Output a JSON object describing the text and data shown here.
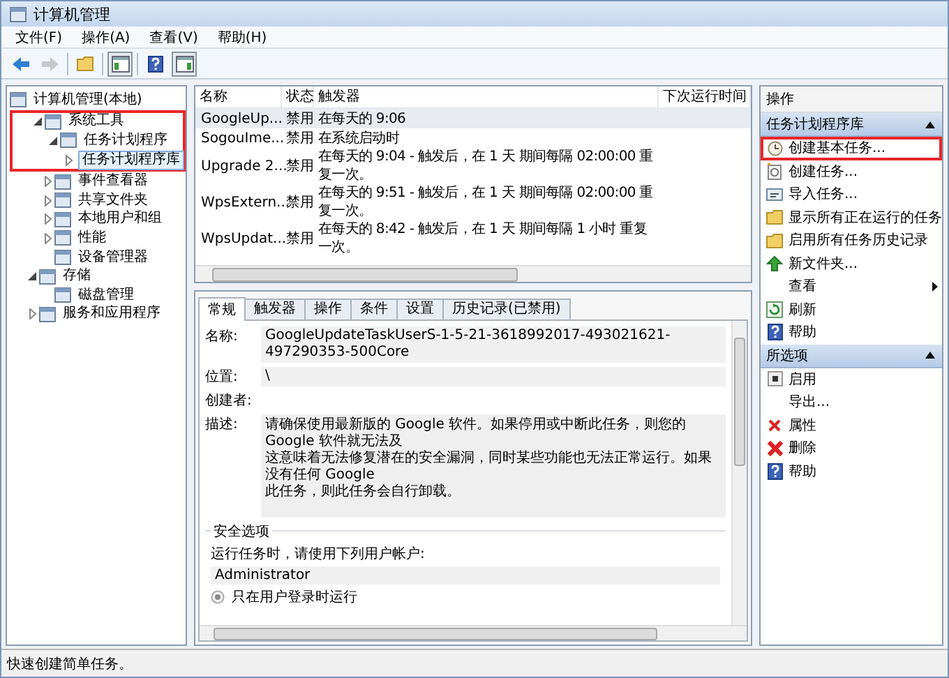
{
  "window": {
    "title": "计算机管理"
  },
  "menu": [
    "文件(F)",
    "操作(A)",
    "查看(V)",
    "帮助(H)"
  ],
  "toolbar": [
    {
      "kind": "back",
      "disabled": false
    },
    {
      "kind": "forward",
      "disabled": true
    },
    {
      "kind": "up",
      "disabled": false
    },
    {
      "kind": "tree-toggle",
      "disabled": false
    },
    {
      "kind": "help",
      "disabled": false
    },
    {
      "kind": "pane-toggle",
      "disabled": false
    }
  ],
  "tree": [
    {
      "label": "计算机管理(本地)",
      "expandable": false,
      "selected": false,
      "highlighted": false,
      "children": [
        {
          "label": "系统工具",
          "expandable": true,
          "expanded": true,
          "selected": false,
          "highlighted": true,
          "children": [
            {
              "label": "任务计划程序",
              "expandable": true,
              "expanded": true,
              "selected": false,
              "highlighted": true,
              "children": [
                {
                  "label": "任务计划程序库",
                  "expandable": true,
                  "expanded": false,
                  "selected": true,
                  "highlighted": true
                }
              ]
            },
            {
              "label": "事件查看器",
              "expandable": true,
              "expanded": false,
              "selected": false,
              "highlighted": false
            },
            {
              "label": "共享文件夹",
              "expandable": true,
              "expanded": false,
              "selected": false,
              "highlighted": false
            },
            {
              "label": "本地用户和组",
              "expandable": true,
              "expanded": false,
              "selected": false,
              "highlighted": false
            },
            {
              "label": "性能",
              "expandable": true,
              "expanded": false,
              "selected": false,
              "highlighted": false
            },
            {
              "label": "设备管理器",
              "expandable": false,
              "selected": false,
              "highlighted": false
            }
          ]
        },
        {
          "label": "存储",
          "expandable": true,
          "expanded": true,
          "selected": false,
          "highlighted": false,
          "children": [
            {
              "label": "磁盘管理",
              "expandable": false,
              "selected": false,
              "highlighted": false
            }
          ]
        },
        {
          "label": "服务和应用程序",
          "expandable": true,
          "expanded": false,
          "selected": false,
          "highlighted": false
        }
      ]
    }
  ],
  "task_list": {
    "columns": [
      "名称",
      "状态",
      "触发器",
      "下次运行时间"
    ],
    "rows": [
      {
        "name": "GoogleUp...",
        "status": "禁用",
        "trigger": "在每天的 9:06",
        "selected": true
      },
      {
        "name": "SogouIme...",
        "status": "禁用",
        "trigger": "在系统启动时",
        "selected": false
      },
      {
        "name": "Upgrade 2...",
        "status": "禁用",
        "trigger": "在每天的 9:04 - 触发后，在 1 天 期间每隔 02:00:00 重复一次。",
        "selected": false
      },
      {
        "name": "WpsExtern...",
        "status": "禁用",
        "trigger": "在每天的 9:51 - 触发后，在 1 天 期间每隔 02:00:00 重复一次。",
        "selected": false
      },
      {
        "name": "WpsUpdat...",
        "status": "禁用",
        "trigger": "在每天的 8:42 - 触发后，在 1 天 期间每隔 1 小时 重复一次。",
        "selected": false
      }
    ]
  },
  "detail": {
    "tabs": [
      {
        "label": "常规",
        "selected": true
      },
      {
        "label": "触发器",
        "selected": false
      },
      {
        "label": "操作",
        "selected": false
      },
      {
        "label": "条件",
        "selected": false
      },
      {
        "label": "设置",
        "selected": false
      },
      {
        "label": "历史记录(已禁用)",
        "selected": false
      }
    ],
    "name_label": "名称:",
    "name_value": "GoogleUpdateTaskUserS-1-5-21-3618992017-493021621-497290353-500Core",
    "location_label": "位置:",
    "location_value": "\\",
    "author_label": "创建者:",
    "description_label": "描述:",
    "description": [
      "请确保使用最新版的 Google 软件。如果停用或中断此任务，则您的 Google 软件就无法及",
      "这意味着无法修复潜在的安全漏洞，同时某些功能也无法正常运行。如果没有任何 Google",
      "此任务，则此任务会自行卸载。"
    ],
    "security": {
      "title": "安全选项",
      "prompt": "运行任务时，请使用下列用户帐户:",
      "account": "Administrator",
      "options": [
        {
          "label": "只在用户登录时运行",
          "selected": true
        }
      ]
    }
  },
  "actions": {
    "title": "操作",
    "sections": [
      {
        "title": "任务计划程序库",
        "expanded": true,
        "items": [
          {
            "kind": "create-basic",
            "label": "创建基本任务...",
            "highlighted": true,
            "submenu": false
          },
          {
            "kind": "create",
            "label": "创建任务...",
            "highlighted": false,
            "submenu": false
          },
          {
            "kind": "import",
            "label": "导入任务...",
            "highlighted": false,
            "submenu": false
          },
          {
            "kind": "show-running",
            "label": "显示所有正在运行的任务",
            "highlighted": false,
            "submenu": false
          },
          {
            "kind": "enable-history",
            "label": "启用所有任务历史记录",
            "highlighted": false,
            "submenu": false
          },
          {
            "kind": "new-folder",
            "label": "新文件夹...",
            "highlighted": false,
            "submenu": false
          },
          {
            "kind": "view",
            "label": "查看",
            "highlighted": false,
            "submenu": true
          },
          {
            "kind": "refresh",
            "label": "刷新",
            "highlighted": false,
            "submenu": false
          },
          {
            "kind": "help",
            "label": "帮助",
            "highlighted": false,
            "submenu": false
          }
        ]
      },
      {
        "title": "所选项",
        "expanded": true,
        "items": [
          {
            "kind": "enable",
            "label": "启用",
            "highlighted": false,
            "submenu": false
          },
          {
            "kind": "export",
            "label": "导出...",
            "highlighted": false,
            "submenu": false
          },
          {
            "kind": "properties",
            "label": "属性",
            "highlighted": false,
            "submenu": false
          },
          {
            "kind": "delete",
            "label": "删除",
            "highlighted": false,
            "submenu": false
          },
          {
            "kind": "help",
            "label": "帮助",
            "highlighted": false,
            "submenu": false
          }
        ]
      }
    ]
  },
  "status_bar": "快速创建简单任务。"
}
